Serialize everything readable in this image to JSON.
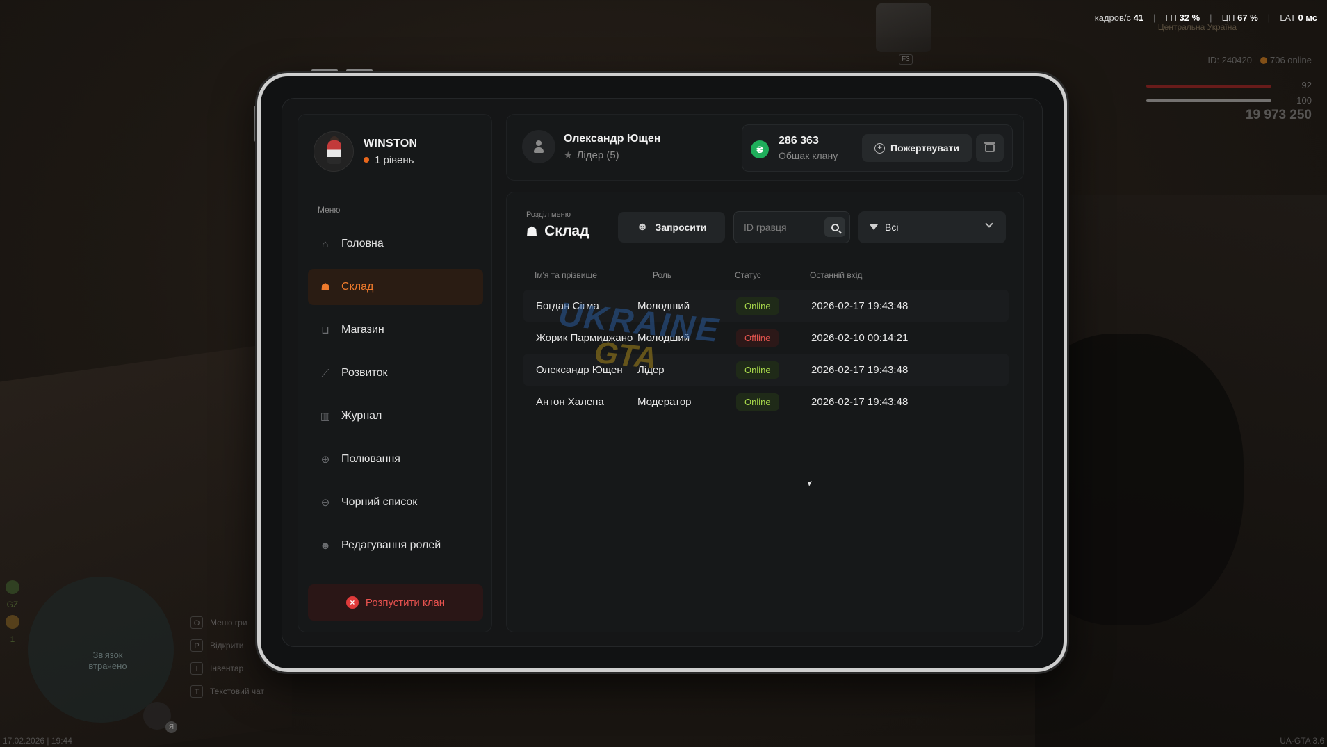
{
  "hud": {
    "fps_label": "кадров/с",
    "fps_value": "41",
    "gpu_label": "ГП",
    "gpu_value": "32 %",
    "cpu_label": "ЦП",
    "cpu_value": "67 %",
    "lat_label": "LAT",
    "lat_value": "0 мс",
    "region": "Центральна Україна",
    "player_id": "ID: 240420",
    "online": "706 online",
    "health": "92",
    "armor": "100",
    "money": "19 973 250",
    "car_key": "F3",
    "minimap_status": "Зв'язок втрачено",
    "wanted_label": "GZ",
    "wanted_level": "1",
    "mic_label": "Я",
    "datetime": "17.02.2026 | 19:44",
    "version": "UA-GTA 3.6",
    "keys": [
      {
        "key": "O",
        "label": "Меню гри"
      },
      {
        "key": "P",
        "label": "Відкрити"
      },
      {
        "key": "I",
        "label": "Інвентар"
      },
      {
        "key": "T",
        "label": "Текстовий чат"
      }
    ]
  },
  "profile": {
    "name": "WINSTON",
    "level": "1 рівень"
  },
  "menu": {
    "title": "Меню",
    "items": [
      {
        "label": "Головна",
        "icon": "home-icon"
      },
      {
        "label": "Склад",
        "icon": "group-icon",
        "active": true
      },
      {
        "label": "Магазин",
        "icon": "basket-icon"
      },
      {
        "label": "Розвиток",
        "icon": "chart-icon"
      },
      {
        "label": "Журнал",
        "icon": "book-icon"
      },
      {
        "label": "Полювання",
        "icon": "crosshair-icon"
      },
      {
        "label": "Чорний список",
        "icon": "block-icon"
      },
      {
        "label": "Редагування ролей",
        "icon": "user-edit-icon"
      }
    ],
    "disband": "Розпустити клан"
  },
  "header": {
    "leader_name": "Олександр Ющен",
    "leader_role": "Лідер (5)",
    "bank_amount": "286 363",
    "bank_label": "Общак клану",
    "bank_icon": "₴",
    "donate": "Пожертвувати"
  },
  "section": {
    "caption": "Розділ меню",
    "title": "Склад",
    "invite": "Запросити",
    "search_placeholder": "ID гравця",
    "filter_value": "Всі"
  },
  "table": {
    "columns": [
      "Ім'я та прізвище",
      "Роль",
      "Статус",
      "Останній вхід"
    ],
    "rows": [
      {
        "name": "Богдан Сігма",
        "role": "Молодший",
        "status": "Online",
        "last": "2026-02-17 19:43:48"
      },
      {
        "name": "Жорик Пармиджано",
        "role": "Молодший",
        "status": "Offline",
        "last": "2026-02-10 00:14:21"
      },
      {
        "name": "Олександр Ющен",
        "role": "Лідер",
        "status": "Online",
        "last": "2026-02-17 19:43:48"
      },
      {
        "name": "Антон Халепа",
        "role": "Модератор",
        "status": "Online",
        "last": "2026-02-17 19:43:48"
      }
    ]
  },
  "watermark": {
    "line1": "UKRAINE",
    "line2": "GTA"
  }
}
